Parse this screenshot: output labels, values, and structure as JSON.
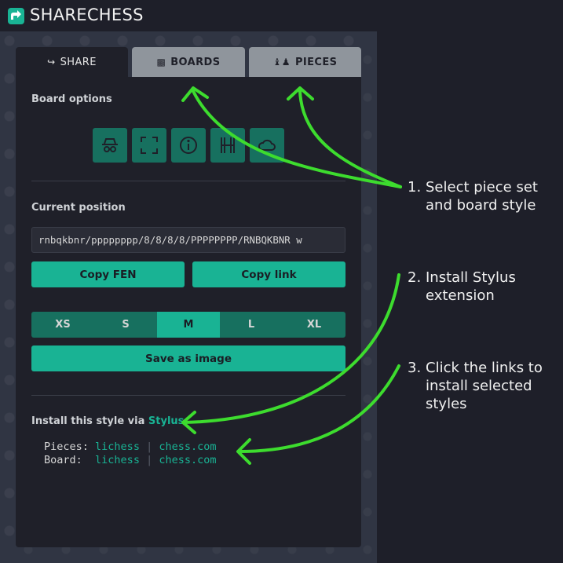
{
  "app": {
    "title": "SHARECHESS",
    "logo_icon": "share-chess-logo-icon",
    "accent": "#19b394"
  },
  "tabs": [
    {
      "label": "SHARE",
      "icon": "share-arrow-icon",
      "active": true
    },
    {
      "label": "BOARDS",
      "icon": "checkerboard-icon",
      "active": false
    },
    {
      "label": "PIECES",
      "icon": "chess-pieces-icon",
      "active": false
    }
  ],
  "board_options": {
    "label": "Board options",
    "buttons": [
      "incognito-icon",
      "fullscreen-icon",
      "info-icon",
      "h-letter-icon",
      "cloud-icon"
    ]
  },
  "position": {
    "label": "Current position",
    "fen": "rnbqkbnr/pppppppp/8/8/8/8/PPPPPPPP/RNBQKBNR w",
    "copy_fen": "Copy FEN",
    "copy_link": "Copy link"
  },
  "image": {
    "sizes": [
      "XS",
      "S",
      "M",
      "L",
      "XL"
    ],
    "selected": "M",
    "save_label": "Save as image"
  },
  "stylus": {
    "prefix": "Install this style via",
    "link": "Stylus",
    "pieces_label": "Pieces:",
    "board_label": "Board: ",
    "lichess": "lichess",
    "chesscom": "chess.com",
    "sep": "|"
  },
  "notes": [
    {
      "num": "1.",
      "line1": "Select piece set",
      "line2": "and board style"
    },
    {
      "num": "2.",
      "line1": "Install Stylus",
      "line2": "extension"
    },
    {
      "num": "3.",
      "line1": "Click the links to",
      "line2": "install selected",
      "line3": "styles"
    }
  ],
  "arrow_color": "#3ddc2e"
}
